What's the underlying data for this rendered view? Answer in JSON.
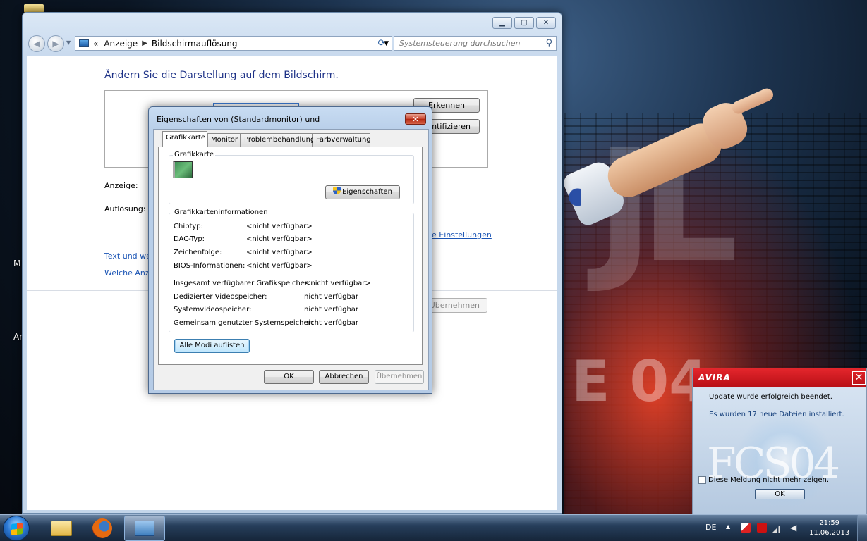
{
  "control_panel": {
    "breadcrumb": [
      "Anzeige",
      "Bildschirmauflösung"
    ],
    "breadcrumb_prefix": "«",
    "search_placeholder": "Systemsteuerung durchsuchen",
    "heading": "Ändern Sie die Darstellung auf dem Bildschirm.",
    "detect_button": "Erkennen",
    "identify_button_partial": "entifizieren",
    "display_label": "Anzeige:",
    "resolution_label": "Auflösung:",
    "advanced_settings_link_partial": "e Einstellungen",
    "text_link_partial": "Text und we",
    "which_display_link_partial": "Welche Anze",
    "apply_button_partial": "Übernehmen"
  },
  "properties_dialog": {
    "title": "Eigenschaften von (Standardmonitor) und",
    "close_glyph": "✕",
    "tabs": [
      "Grafikkarte",
      "Monitor",
      "Problembehandlung",
      "Farbverwaltung"
    ],
    "adapter_group_title": "Grafikkarte",
    "properties_button": "Eigenschaften",
    "info_group_title": "Grafikkarteninformationen",
    "info_rows": [
      {
        "label": "Chiptyp:",
        "value": "<nicht verfügbar>"
      },
      {
        "label": "DAC-Typ:",
        "value": "<nicht verfügbar>"
      },
      {
        "label": "Zeichenfolge:",
        "value": "<nicht verfügbar>"
      },
      {
        "label": "BIOS-Informationen:",
        "value": "<nicht verfügbar>"
      }
    ],
    "memory_rows": [
      {
        "label": "Insgesamt verfügbarer Grafikspeicher:",
        "value": "<nicht verfügbar>"
      },
      {
        "label": "Dedizierter Videospeicher:",
        "value": "nicht verfügbar"
      },
      {
        "label": "Systemvideospeicher:",
        "value": "nicht verfügbar"
      },
      {
        "label": "Gemeinsam genutzter Systemspeicher:",
        "value": "nicht verfügbar"
      }
    ],
    "list_modes_button": "Alle Modi auflisten",
    "ok_button": "OK",
    "cancel_button": "Abbrechen",
    "apply_button": "Übernehmen"
  },
  "avira_popup": {
    "brand": "AVIRA",
    "close_glyph": "✕",
    "message_line1": "Update wurde erfolgreich beendet.",
    "message_line2": "Es wurden 17 neue Dateien installiert.",
    "dont_show_label": "Diese Meldung nicht mehr zeigen.",
    "ok_button": "OK",
    "watermark": "FCS04"
  },
  "desktop": {
    "icon_label_fragments": [
      "M",
      "Ar"
    ],
    "wallpaper_text": [
      "JL",
      "E 04"
    ]
  },
  "taskbar": {
    "language": "DE",
    "time": "21:59",
    "date": "11.06.2013",
    "apps": [
      "folder-icon",
      "firefox-icon",
      "control-panel-icon"
    ]
  },
  "colors": {
    "heading_blue": "#1e3287",
    "link_blue": "#1b55b5",
    "avira_red": "#d01a21",
    "focus_blue": "#3c7fb1"
  }
}
